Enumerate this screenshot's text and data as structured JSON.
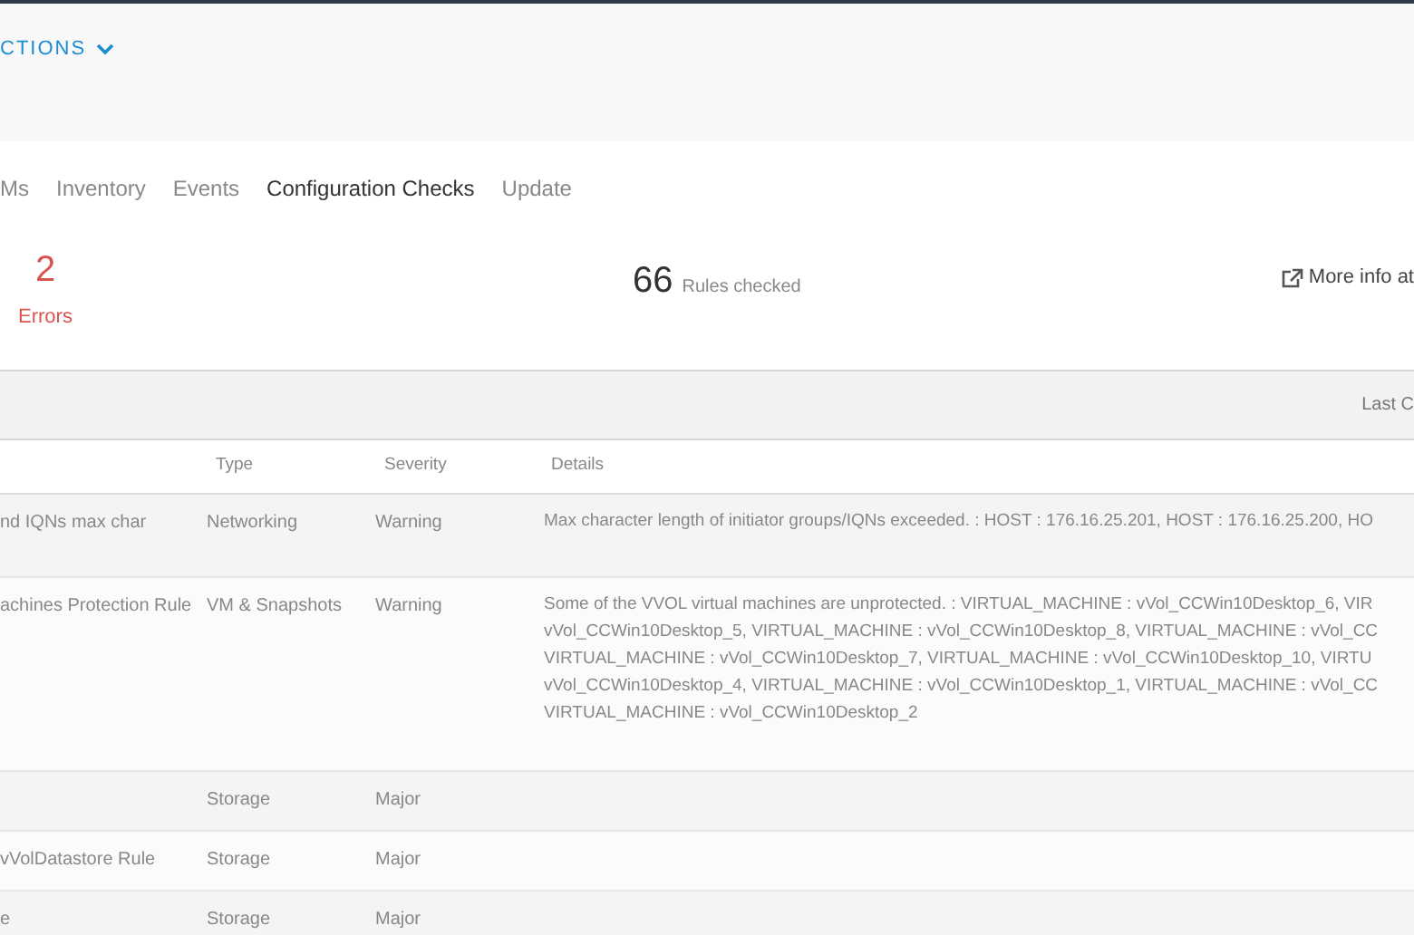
{
  "header": {
    "actions_label": "CTIONS"
  },
  "tabs": [
    {
      "label": "Ms",
      "selected": false
    },
    {
      "label": "Inventory",
      "selected": false
    },
    {
      "label": "Events",
      "selected": false
    },
    {
      "label": "Configuration Checks",
      "selected": true
    },
    {
      "label": "Update",
      "selected": false
    }
  ],
  "summary": {
    "errors_count": "2",
    "errors_label": "Errors",
    "rules_count": "66",
    "rules_label": "Rules checked",
    "more_info": "More info at"
  },
  "toolbar": {
    "last_checked": "Last C"
  },
  "table": {
    "columns": [
      "Type",
      "Severity",
      "Details"
    ],
    "rows": [
      {
        "name": "nd IQNs max char",
        "type": "Networking",
        "severity": "Warning",
        "details": [
          "Max character length of initiator groups/IQNs exceeded. : HOST : 176.16.25.201, HOST : 176.16.25.200, HO"
        ]
      },
      {
        "name": "achines Protection Rule",
        "type": "VM & Snapshots",
        "severity": "Warning",
        "details": [
          "Some of the VVOL virtual machines are unprotected. : VIRTUAL_MACHINE : vVol_CCWin10Desktop_6, VIR",
          "vVol_CCWin10Desktop_5, VIRTUAL_MACHINE : vVol_CCWin10Desktop_8, VIRTUAL_MACHINE : vVol_CC",
          "VIRTUAL_MACHINE : vVol_CCWin10Desktop_7, VIRTUAL_MACHINE : vVol_CCWin10Desktop_10, VIRTU",
          "vVol_CCWin10Desktop_4, VIRTUAL_MACHINE : vVol_CCWin10Desktop_1, VIRTUAL_MACHINE : vVol_CC",
          "VIRTUAL_MACHINE : vVol_CCWin10Desktop_2"
        ]
      },
      {
        "name": "",
        "type": "Storage",
        "severity": "Major",
        "details": []
      },
      {
        "name": "vVolDatastore Rule",
        "type": "Storage",
        "severity": "Major",
        "details": []
      },
      {
        "name": "e",
        "type": "Storage",
        "severity": "Major",
        "details": []
      }
    ]
  }
}
